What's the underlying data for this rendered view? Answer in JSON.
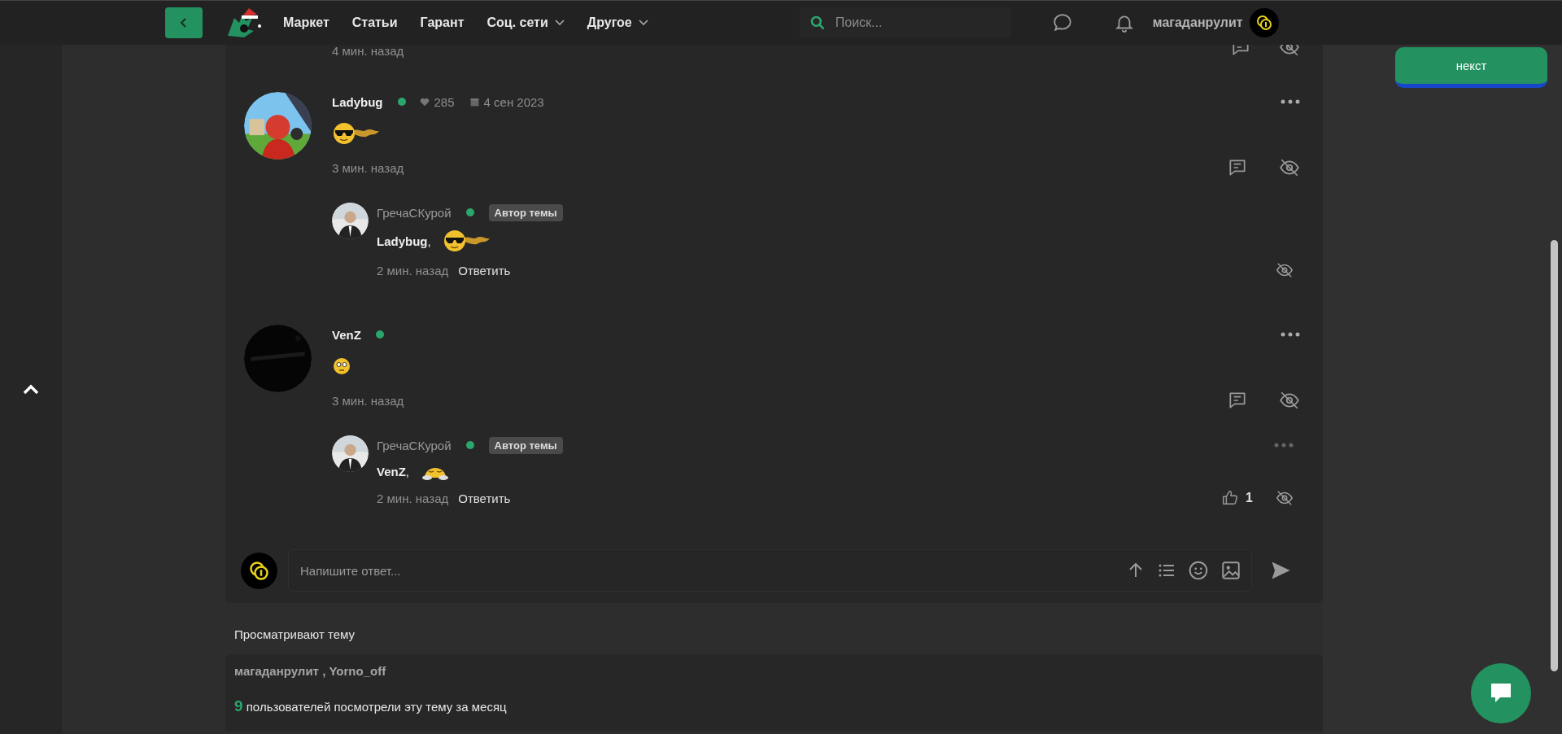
{
  "topbar": {
    "nav": [
      {
        "label": "Маркет",
        "dropdown": false
      },
      {
        "label": "Статьи",
        "dropdown": false
      },
      {
        "label": "Гарант",
        "dropdown": false
      },
      {
        "label": "Соц. сети",
        "dropdown": true
      },
      {
        "label": "Другое",
        "dropdown": true
      }
    ],
    "search": {
      "placeholder": "Поиск..."
    },
    "username": "магаданрулит"
  },
  "float_button": {
    "label": "некст"
  },
  "partial": {
    "time": "4 мин. назад"
  },
  "comments": [
    {
      "author": "Ladybug",
      "online": true,
      "likes": "285",
      "date": "4 сен 2023",
      "emoji": {
        "kind": "cool"
      },
      "time": "3 мин. назад",
      "replies": [
        {
          "author": "ГречаСКурой",
          "online": true,
          "badge": "Автор темы",
          "text": "**Ladybug**,",
          "emoji": {
            "kind": "cool"
          },
          "time": "2 мин. назад",
          "reply_label": "Ответить",
          "has_menu": false
        }
      ]
    },
    {
      "author": "VenZ",
      "online": true,
      "emoji": {
        "kind": "shy"
      },
      "time": "3 мин. назад",
      "replies": [
        {
          "author": "ГречаСКурой",
          "online": true,
          "badge": "Автор темы",
          "text": "**VenZ**,",
          "emoji": {
            "kind": "sleepy"
          },
          "time": "2 мин. назад",
          "reply_label": "Ответить",
          "has_menu": true,
          "likes": "1"
        }
      ]
    }
  ],
  "composer": {
    "placeholder": "Напишите ответ..."
  },
  "viewers": {
    "title": "Просматривают тему",
    "names": "магаданрулит , Yorno_off",
    "count_text": "**9** пользователей посмотрели эту тему за месяц"
  }
}
